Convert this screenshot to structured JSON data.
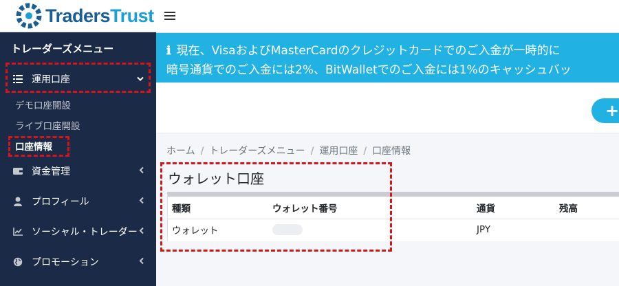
{
  "brand": {
    "part1": "Traders",
    "part2": "Trust",
    "primary_color": "#1a5e96",
    "secondary_color": "#1aa0d8",
    "mark_icon": "logo-mark-icon"
  },
  "sidebar": {
    "menu_title": "トレーダーズメニュー",
    "bg_color": "#1b2a47",
    "items": [
      {
        "label": "運用口座",
        "icon": "list-icon",
        "chevron": "chevron-down-icon",
        "expanded": true,
        "children": [
          {
            "label": "デモ口座開設"
          },
          {
            "label": "ライブ口座開設"
          },
          {
            "label": "口座情報",
            "current": true
          }
        ]
      },
      {
        "label": "資金管理",
        "icon": "wallet-icon",
        "chevron": "chevron-left-icon"
      },
      {
        "label": "プロフィール",
        "icon": "user-icon",
        "chevron": "chevron-left-icon"
      },
      {
        "label": "ソーシャル・トレーダー",
        "icon": "chart-icon",
        "chevron": "chevron-left-icon"
      },
      {
        "label": "プロモーション",
        "icon": "globe-icon",
        "chevron": "chevron-left-icon"
      }
    ]
  },
  "topbar": {
    "menu_icon": "hamburger-icon"
  },
  "notice": {
    "icon": "info-icon",
    "line1": "現在、VisaおよびMasterCardのクレジットカードでのご入金が一時的に",
    "line2": "暗号通貨でのご入金には2%、BitWalletでのご入金には1%のキャッシュバッ",
    "bg_color": "#22b1e3"
  },
  "actions": {
    "add_label": "+"
  },
  "breadcrumb": [
    "ホーム",
    "トレーダーズメニュー",
    "運用口座",
    "口座情報"
  ],
  "wallet": {
    "title": "ウォレット口座",
    "columns": [
      "種類",
      "ウォレット番号",
      "通貨",
      "残高"
    ],
    "rows": [
      {
        "type": "ウォレット",
        "number": "",
        "currency": "JPY",
        "balance": ""
      }
    ]
  },
  "highlight_color": "#d8141b"
}
